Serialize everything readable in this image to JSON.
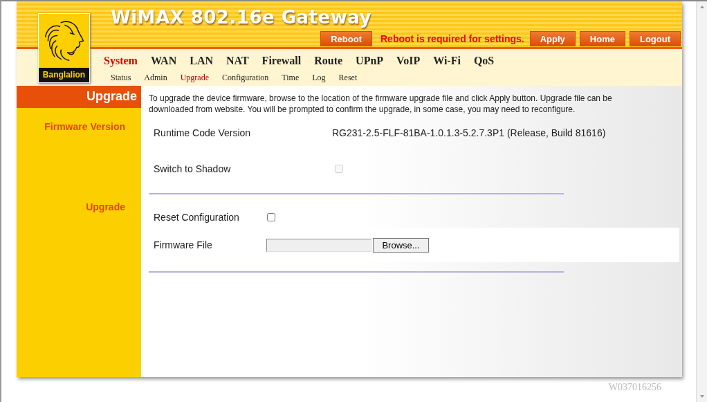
{
  "header": {
    "title": "WiMAX 802.16e Gateway",
    "logo_text": "Banglalion",
    "toolbar": [
      {
        "kind": "button",
        "label": "Reboot"
      },
      {
        "kind": "notice",
        "label": "Reboot is required for settings."
      },
      {
        "kind": "button",
        "label": "Apply"
      },
      {
        "kind": "button",
        "label": "Home"
      },
      {
        "kind": "button",
        "label": "Logout"
      }
    ]
  },
  "main_nav": [
    {
      "label": "System",
      "selected": true
    },
    {
      "label": "WAN",
      "selected": false
    },
    {
      "label": "LAN",
      "selected": false
    },
    {
      "label": "NAT",
      "selected": false
    },
    {
      "label": "Firewall",
      "selected": false
    },
    {
      "label": "Route",
      "selected": false
    },
    {
      "label": "UPnP",
      "selected": false
    },
    {
      "label": "VoIP",
      "selected": false
    },
    {
      "label": "Wi-Fi",
      "selected": false
    },
    {
      "label": "QoS",
      "selected": false
    }
  ],
  "sub_nav": [
    {
      "label": "Status",
      "selected": false
    },
    {
      "label": "Admin",
      "selected": false
    },
    {
      "label": "Upgrade",
      "selected": true
    },
    {
      "label": "Configuration",
      "selected": false
    },
    {
      "label": "Time",
      "selected": false
    },
    {
      "label": "Log",
      "selected": false
    },
    {
      "label": "Reset",
      "selected": false
    }
  ],
  "sidebar": {
    "title": "Upgrade",
    "sections": [
      "Firmware Version",
      "Upgrade"
    ]
  },
  "description": "To upgrade the device firmware, browse to the location of the firmware upgrade file and click Apply button. Upgrade file can be downloaded from website. You will be prompted to confirm the upgrade, in some case, you may need to reconfigure.",
  "runtime": {
    "label": "Runtime Code Version",
    "value": "RG231-2.5-FLF-81BA-1.0.1.3-5.2.7.3P1 (Release, Build 81616)"
  },
  "switch_to_shadow": {
    "label": "Switch to Shadow",
    "checked": false,
    "disabled": true
  },
  "reset_configuration": {
    "label": "Reset Configuration",
    "checked": false,
    "disabled": false
  },
  "firmware_file": {
    "label": "Firmware File",
    "button": "Browse..."
  },
  "footer": "W037016256"
}
